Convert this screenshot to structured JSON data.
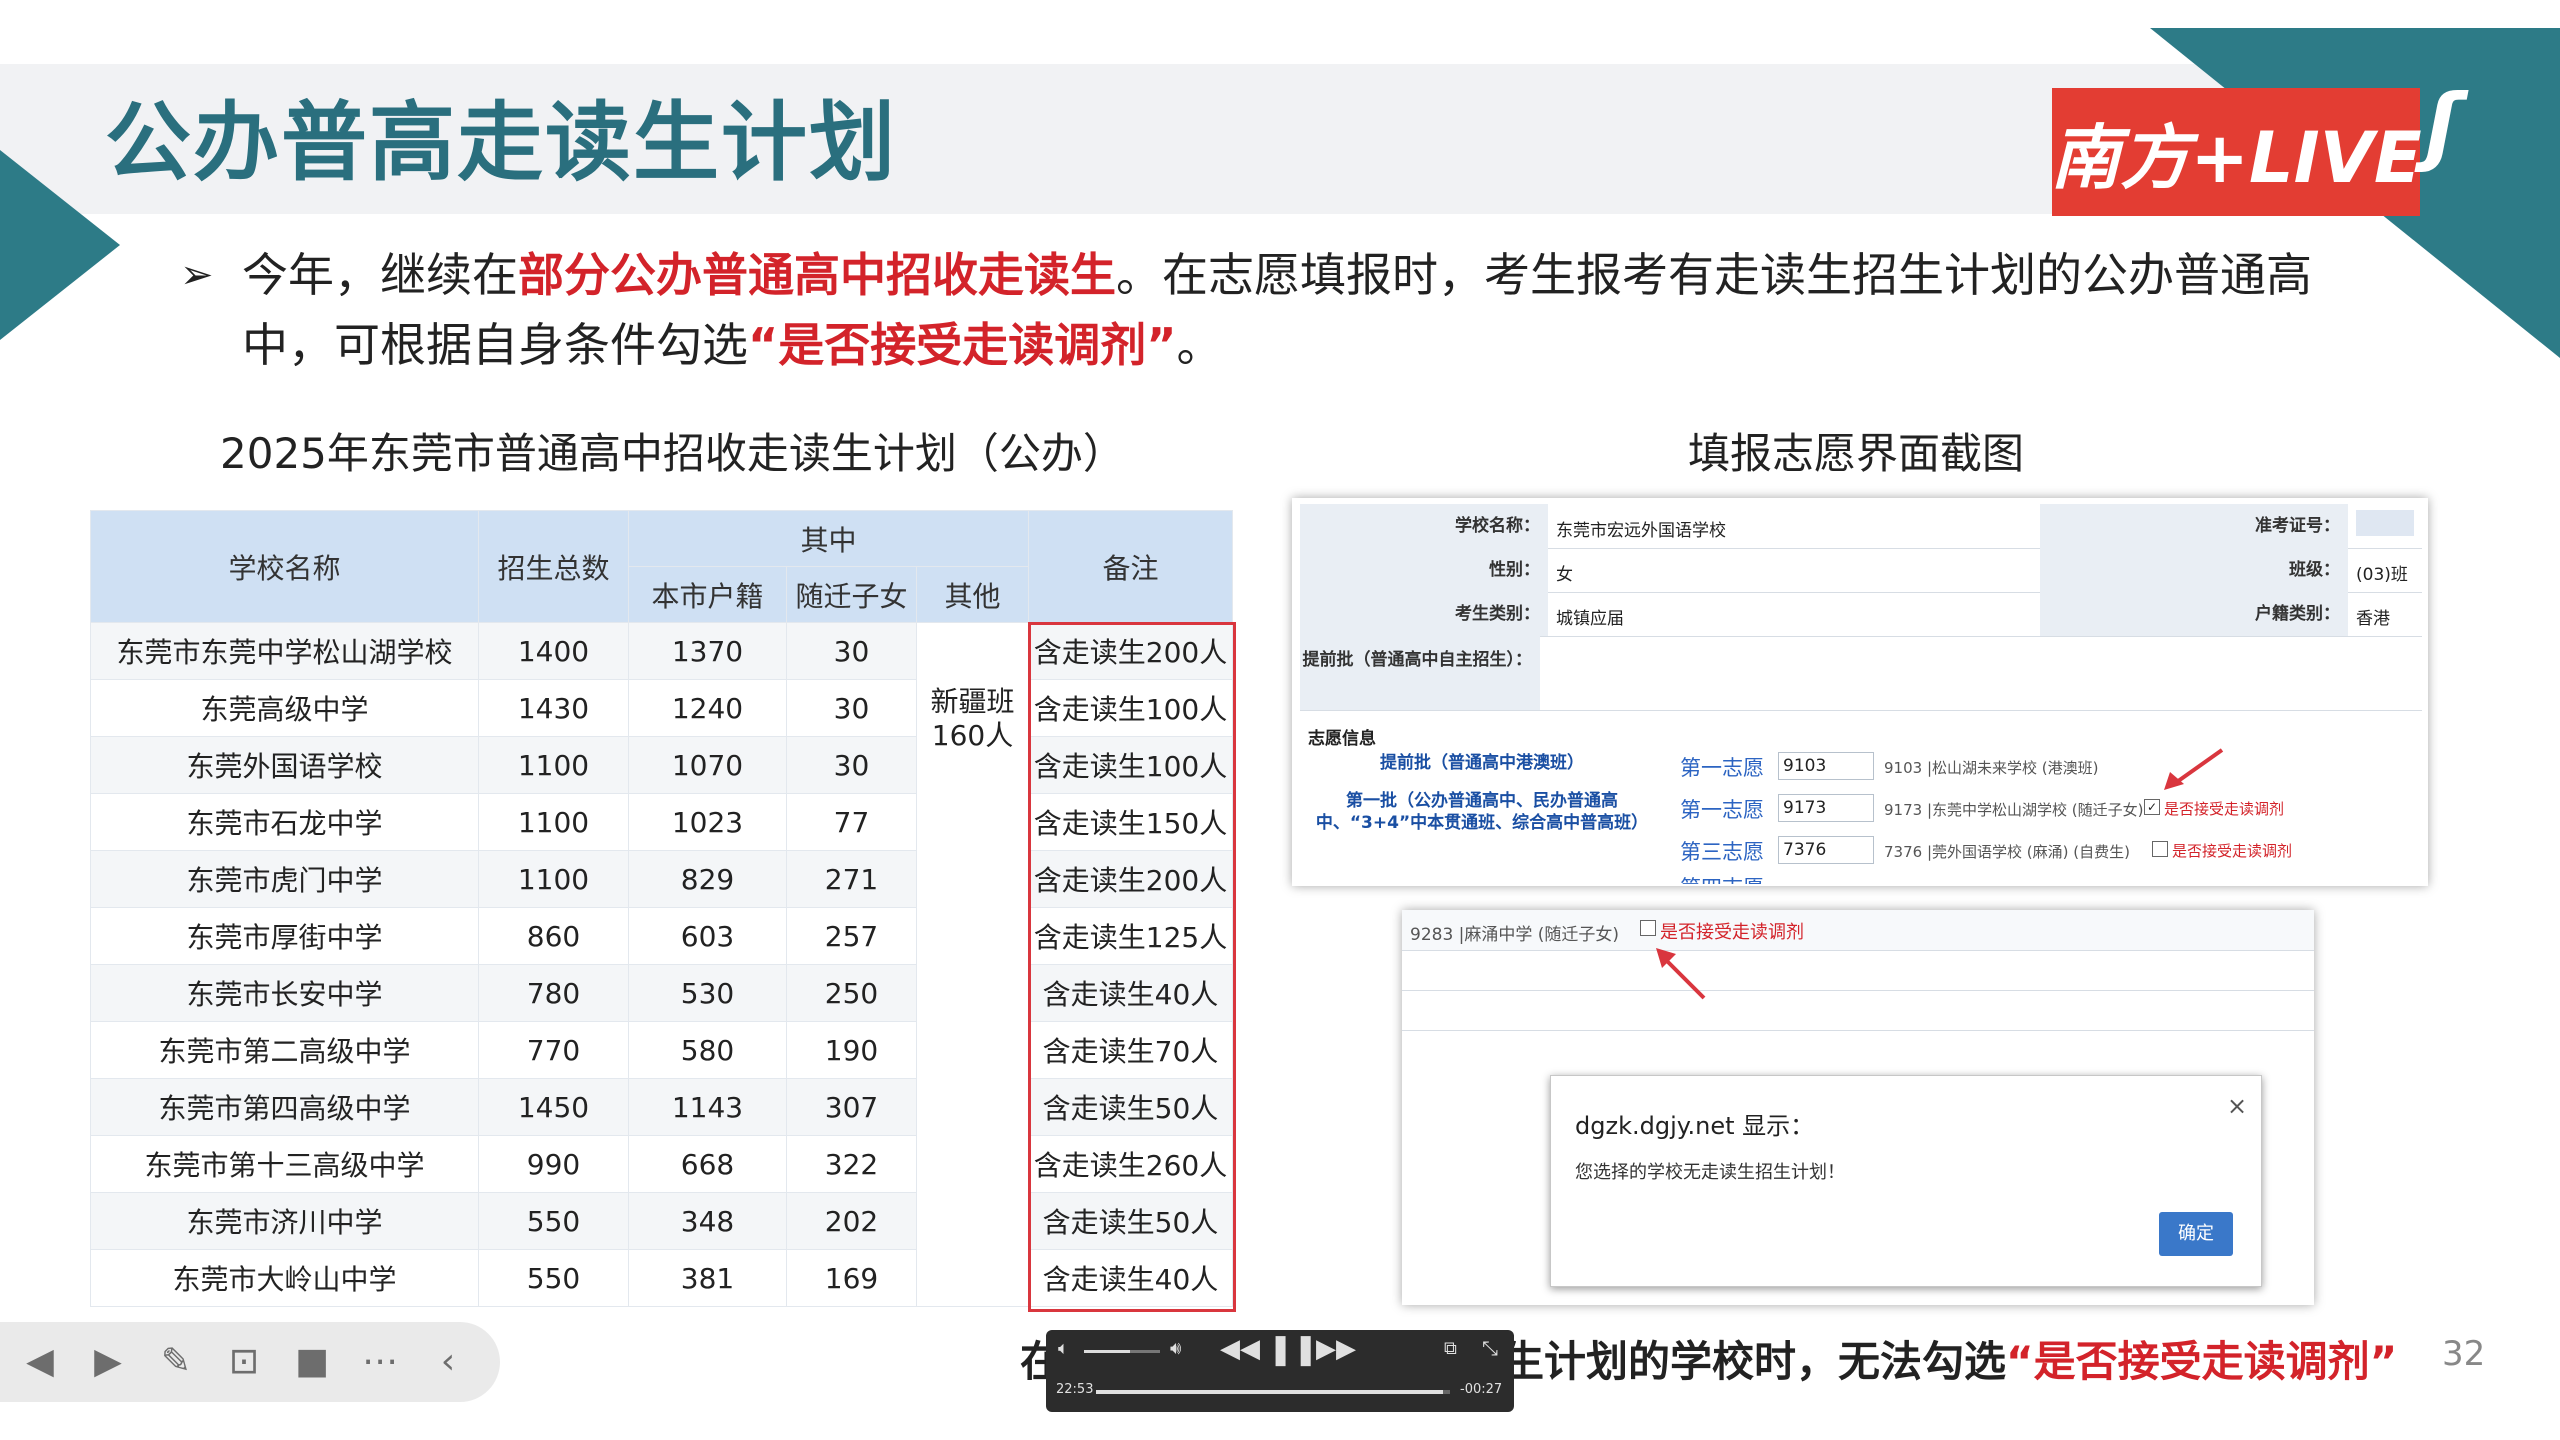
{
  "slide": {
    "title": "公办普高走读生计划",
    "bullet": {
      "p1": "今年，继续在",
      "p2": "部分公办普通高中招收走读生",
      "p3": "。在志愿填报时，考生报考有走读生招生计划的公办普通高中，可根据自身条件勾选",
      "p4": "“是否接受走读调剂”",
      "p5": "。"
    },
    "left_heading": "2025年东莞市普通高中招收走读生计划（公办）",
    "right_heading": "填报志愿界面截图",
    "badge": "南方+LIVE",
    "page_number": "32",
    "footer_a": "在",
    "footer_b": "报考无走读生计划的学校时，无法勾选",
    "footer_c": "“是否接受走读调剂”"
  },
  "table": {
    "headers": {
      "school": "学校名称",
      "total": "招生总数",
      "of_which": "其中",
      "local": "本市户籍",
      "migrant": "随迁子女",
      "other": "其他",
      "note": "备注"
    },
    "other_merged": "新疆班160人",
    "rows": [
      {
        "school": "东莞市东莞中学松山湖学校",
        "total": "1400",
        "local": "1370",
        "migrant": "30",
        "note": "含走读生200人"
      },
      {
        "school": "东莞高级中学",
        "total": "1430",
        "local": "1240",
        "migrant": "30",
        "note": "含走读生100人"
      },
      {
        "school": "东莞外国语学校",
        "total": "1100",
        "local": "1070",
        "migrant": "30",
        "note": "含走读生100人"
      },
      {
        "school": "东莞市石龙中学",
        "total": "1100",
        "local": "1023",
        "migrant": "77",
        "note": "含走读生150人"
      },
      {
        "school": "东莞市虎门中学",
        "total": "1100",
        "local": "829",
        "migrant": "271",
        "note": "含走读生200人"
      },
      {
        "school": "东莞市厚街中学",
        "total": "860",
        "local": "603",
        "migrant": "257",
        "note": "含走读生125人"
      },
      {
        "school": "东莞市长安中学",
        "total": "780",
        "local": "530",
        "migrant": "250",
        "note": "含走读生40人"
      },
      {
        "school": "东莞市第二高级中学",
        "total": "770",
        "local": "580",
        "migrant": "190",
        "note": "含走读生70人"
      },
      {
        "school": "东莞市第四高级中学",
        "total": "1450",
        "local": "1143",
        "migrant": "307",
        "note": "含走读生50人"
      },
      {
        "school": "东莞市第十三高级中学",
        "total": "990",
        "local": "668",
        "migrant": "322",
        "note": "含走读生260人"
      },
      {
        "school": "东莞市济川中学",
        "total": "550",
        "local": "348",
        "migrant": "202",
        "note": "含走读生50人"
      },
      {
        "school": "东莞市大岭山中学",
        "total": "550",
        "local": "381",
        "migrant": "169",
        "note": "含走读生40人"
      }
    ]
  },
  "form": {
    "school_label": "学校名称：",
    "school_value": "东莞市宏远外国语学校",
    "exam_no_label": "准考证号：",
    "gender_label": "性别：",
    "gender_value": "女",
    "class_label": "班级：",
    "class_value": "(03)班",
    "type_label": "考生类别：",
    "type_value": "城镇应届",
    "hukou_label": "户籍类别：",
    "hukou_value": "香港",
    "early_label": "提前批（普通高中自主招生）：",
    "volunteer_title": "志愿信息",
    "cat1": "提前批（普通高中港澳班）",
    "cat2": "第一批（公办普通高中、民办普通高中、“3+4”中本贯通班、综合高中普高班）",
    "v1_rank": "第一志愿",
    "v1_code": "9103",
    "v1_school": "9103 |松山湖未来学校 (港澳班)",
    "v2_rank": "第一志愿",
    "v2_code": "9173",
    "v2_school": "9173 |东莞中学松山湖学校 (随迁子女)",
    "v3_rank": "第三志愿",
    "v3_code": "7376",
    "v3_school": "7376 |莞外国语学校 (麻涌) (自费生)",
    "adjust_label": "是否接受走读调剂",
    "v4_rank": "第四志愿"
  },
  "form2": {
    "row_school": "9283 |麻涌中学 (随迁子女)",
    "adjust_label": "是否接受走读调剂"
  },
  "dialog": {
    "title": "dgzk.dgjy.net 显示：",
    "message": "您选择的学校无走读生招生计划！",
    "ok": "确定",
    "close": "×"
  },
  "media": {
    "time_elapsed": "22:53",
    "time_remaining": "-00:27",
    "progress": 0.98,
    "volume": 0.6
  },
  "icons": [
    "prev-icon",
    "play-icon",
    "pen-icon",
    "screenshot-icon",
    "camera-icon",
    "more-icon",
    "collapse-icon"
  ]
}
